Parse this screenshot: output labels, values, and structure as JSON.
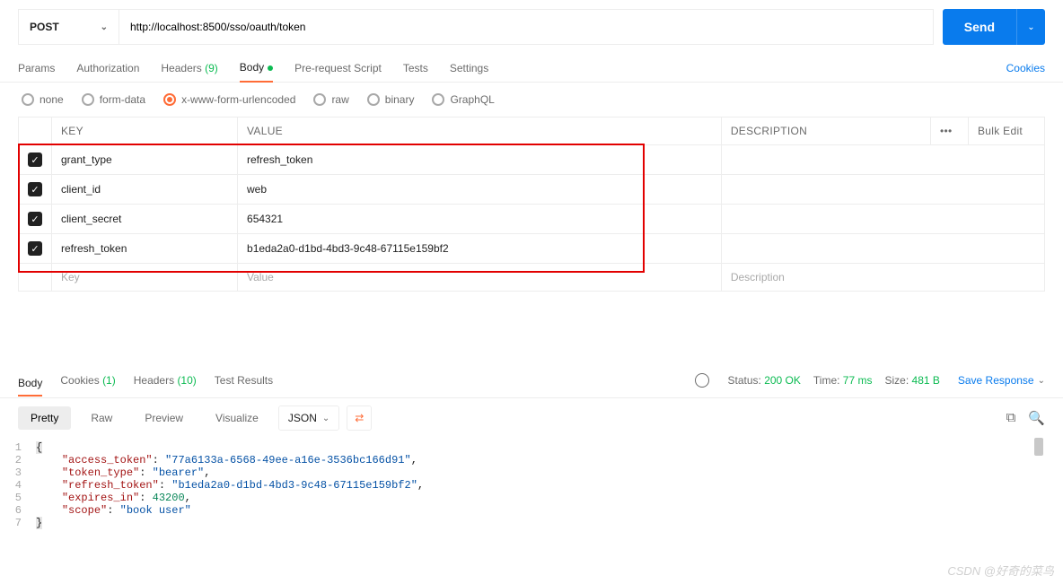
{
  "request": {
    "method": "POST",
    "url": "http://localhost:8500/sso/oauth/token",
    "send_label": "Send"
  },
  "tabs": {
    "params": "Params",
    "authorization": "Authorization",
    "headers": "Headers",
    "headers_count": "(9)",
    "body": "Body",
    "prerequest": "Pre-request Script",
    "tests": "Tests",
    "settings": "Settings",
    "cookies": "Cookies"
  },
  "body_types": {
    "none": "none",
    "formdata": "form-data",
    "xwww": "x-www-form-urlencoded",
    "raw": "raw",
    "binary": "binary",
    "graphql": "GraphQL"
  },
  "params_table": {
    "headers": {
      "key": "KEY",
      "value": "VALUE",
      "description": "DESCRIPTION",
      "bulk": "Bulk Edit",
      "more": "•••"
    },
    "rows": [
      {
        "key": "grant_type",
        "value": "refresh_token"
      },
      {
        "key": "client_id",
        "value": "web"
      },
      {
        "key": "client_secret",
        "value": "654321"
      },
      {
        "key": "refresh_token",
        "value": "b1eda2a0-d1bd-4bd3-9c48-67115e159bf2"
      }
    ],
    "placeholders": {
      "key": "Key",
      "value": "Value",
      "description": "Description"
    }
  },
  "response": {
    "tabs": {
      "body": "Body",
      "cookies": "Cookies",
      "cookies_count": "(1)",
      "headers": "Headers",
      "headers_count": "(10)",
      "test_results": "Test Results"
    },
    "status_label": "Status:",
    "status_value": "200 OK",
    "time_label": "Time:",
    "time_value": "77 ms",
    "size_label": "Size:",
    "size_value": "481 B",
    "save_response": "Save Response"
  },
  "pretty_bar": {
    "pretty": "Pretty",
    "raw": "Raw",
    "preview": "Preview",
    "visualize": "Visualize",
    "json": "JSON"
  },
  "json_body": {
    "access_token_key": "\"access_token\"",
    "access_token_val": "\"77a6133a-6568-49ee-a16e-3536bc166d91\"",
    "token_type_key": "\"token_type\"",
    "token_type_val": "\"bearer\"",
    "refresh_token_key": "\"refresh_token\"",
    "refresh_token_val": "\"b1eda2a0-d1bd-4bd3-9c48-67115e159bf2\"",
    "expires_in_key": "\"expires_in\"",
    "expires_in_val": "43200",
    "scope_key": "\"scope\"",
    "scope_val": "\"book user\""
  },
  "watermark": "CSDN @好奇的菜鸟"
}
